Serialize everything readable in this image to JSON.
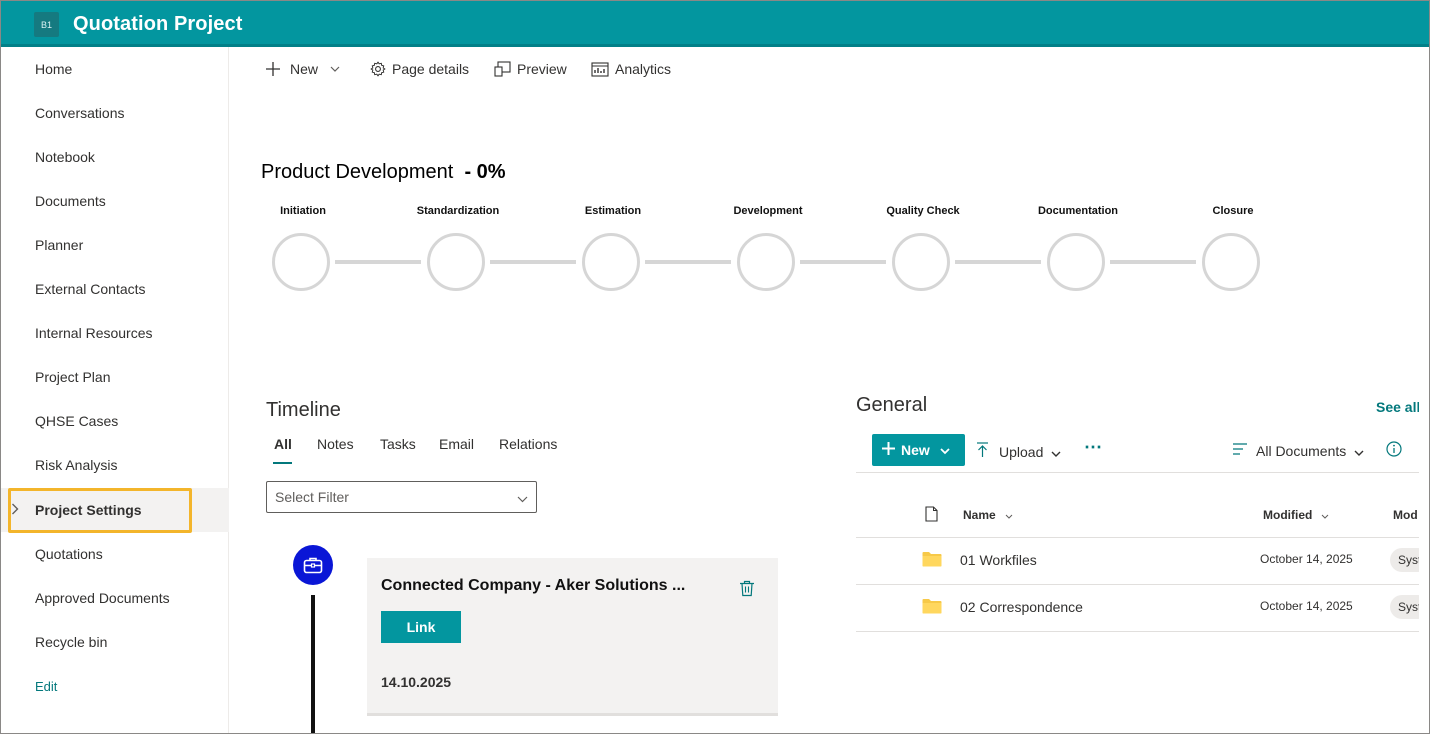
{
  "header": {
    "logo_text": "B1",
    "site_title": "Quotation Project"
  },
  "leftnav": {
    "items": [
      {
        "label": "Home"
      },
      {
        "label": "Conversations"
      },
      {
        "label": "Notebook"
      },
      {
        "label": "Documents"
      },
      {
        "label": "Planner"
      },
      {
        "label": "External Contacts"
      },
      {
        "label": "Internal Resources"
      },
      {
        "label": "Project Plan"
      },
      {
        "label": "QHSE Cases"
      },
      {
        "label": "Risk Analysis"
      },
      {
        "label": "Project Settings",
        "selected": true,
        "expandable": true
      },
      {
        "label": "Quotations",
        "highlighted": true
      },
      {
        "label": "Approved Documents"
      },
      {
        "label": "Recycle bin"
      }
    ],
    "edit_label": "Edit",
    "highlight_color": "#f3b52b"
  },
  "commandbar": {
    "new_label": "New",
    "page_details_label": "Page details",
    "preview_label": "Preview",
    "analytics_label": "Analytics"
  },
  "progress": {
    "title": "Product Development",
    "percent_text": "- 0%",
    "stages": [
      "Initiation",
      "Standardization",
      "Estimation",
      "Development",
      "Quality Check",
      "Documentation",
      "Closure"
    ]
  },
  "timeline": {
    "title": "Timeline",
    "tabs": [
      "All",
      "Notes",
      "Tasks",
      "Email",
      "Relations"
    ],
    "active_tab": "All",
    "filter_placeholder": "Select Filter",
    "card": {
      "title": "Connected Company - Aker Solutions ...",
      "button_label": "Link",
      "date": "14.10.2025",
      "icon": "briefcase-icon"
    }
  },
  "library": {
    "title": "General",
    "see_all": "See all",
    "new_label": "New",
    "upload_label": "Upload",
    "more_label": "⋯",
    "view_label": "All Documents",
    "columns": {
      "name": "Name",
      "modified": "Modified",
      "modified_by": "Mod"
    },
    "rows": [
      {
        "name": "01 Workfiles",
        "modified": "October 14, 2025",
        "modified_by": "Syst"
      },
      {
        "name": "02 Correspondence",
        "modified": "October 14, 2025",
        "modified_by": "Syst"
      }
    ]
  },
  "colors": {
    "brand": "#03969f",
    "accent_text": "#03787c",
    "badge_blue": "#0a16d6"
  }
}
